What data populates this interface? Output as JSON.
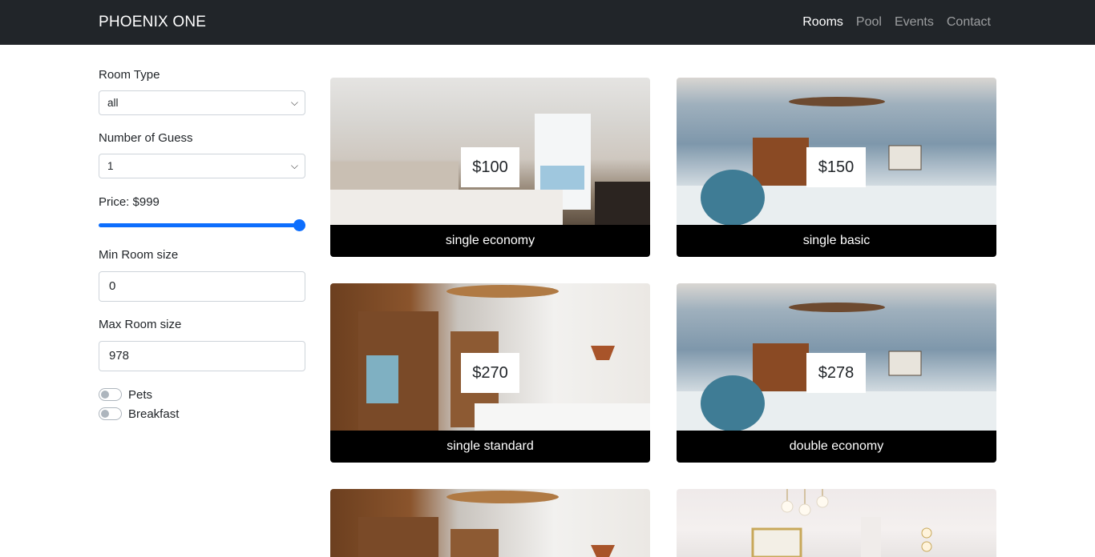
{
  "nav": {
    "brand": "PHOENIX ONE",
    "links": [
      "Rooms",
      "Pool",
      "Events",
      "Contact"
    ],
    "active": "Rooms"
  },
  "filters": {
    "room_type_label": "Room Type",
    "room_type_value": "all",
    "guests_label": "Number of Guess",
    "guests_value": "1",
    "price_label": "Price: $999",
    "price_fraction": 1.0,
    "min_size_label": "Min Room size",
    "min_size_value": "0",
    "max_size_label": "Max Room size",
    "max_size_value": "978",
    "pets_label": "Pets",
    "breakfast_label": "Breakfast"
  },
  "rooms": [
    {
      "price": "$100",
      "name": "single economy"
    },
    {
      "price": "$150",
      "name": "single basic"
    },
    {
      "price": "$270",
      "name": "single standard"
    },
    {
      "price": "$278",
      "name": "double economy"
    },
    {
      "price": "",
      "name": ""
    },
    {
      "price": "",
      "name": ""
    }
  ],
  "colors": {
    "navbar": "#212529",
    "accent": "#0d6efd",
    "caption_bg": "#000000"
  }
}
